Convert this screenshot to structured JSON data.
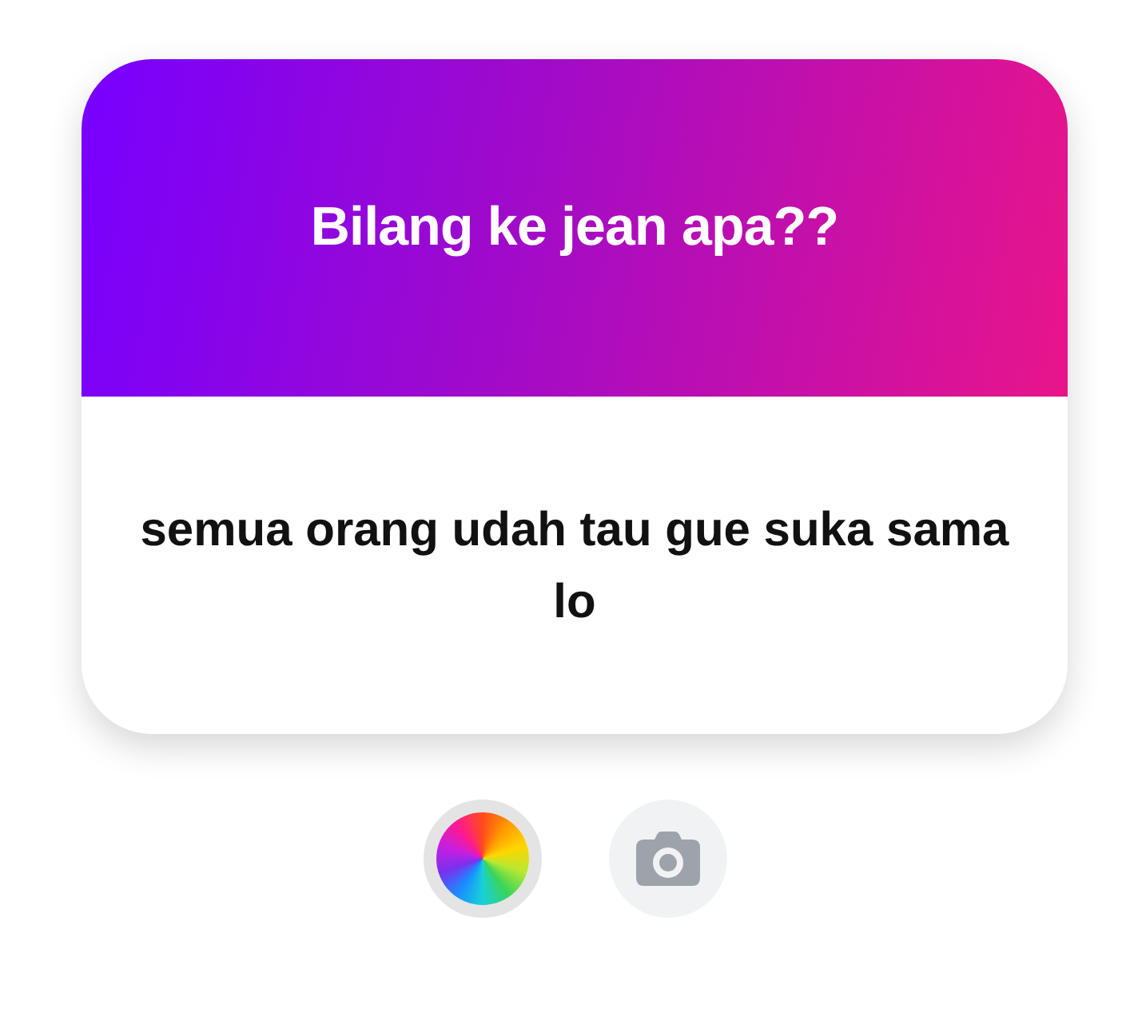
{
  "card": {
    "title": "Bilang ke jean apa??",
    "message": "semua orang udah tau gue suka sama lo"
  },
  "buttons": [
    {
      "kind": "color",
      "selected": true
    },
    {
      "kind": "camera",
      "selected": false
    }
  ]
}
